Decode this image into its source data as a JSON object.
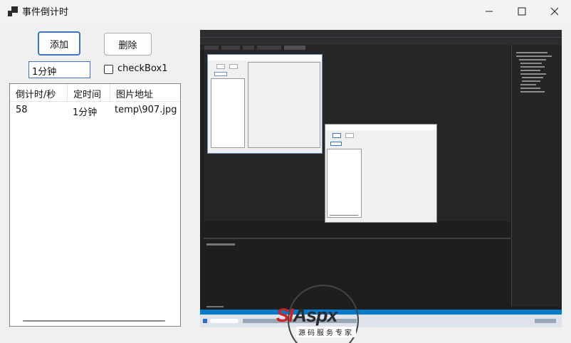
{
  "window": {
    "title": "事件倒计时",
    "controls": {
      "minimize": "—",
      "maximize": "☐",
      "close": "✕"
    }
  },
  "toolbar": {
    "add_label": "添加",
    "delete_label": "删除"
  },
  "input": {
    "value": "1分钟"
  },
  "checkbox": {
    "label": "checkBox1",
    "checked": false
  },
  "listview": {
    "columns": [
      "倒计时/秒",
      "定时间",
      "图片地址"
    ],
    "rows": [
      {
        "countdown": "58",
        "time": "1分钟",
        "path": "temp\\907.jpg"
      }
    ]
  },
  "watermark": {
    "brand_red": "SI",
    "brand_dark": "Aspx",
    "tagline": "源码服务专家"
  },
  "colors": {
    "accent": "#3a76c4",
    "vs_dark": "#1e1e1e",
    "vs_blue": "#007acc",
    "watermark_red": "#d42020"
  },
  "icons": {
    "app": "window-app-icon",
    "minimize": "minimize-icon",
    "maximize": "maximize-icon",
    "close": "close-icon"
  }
}
